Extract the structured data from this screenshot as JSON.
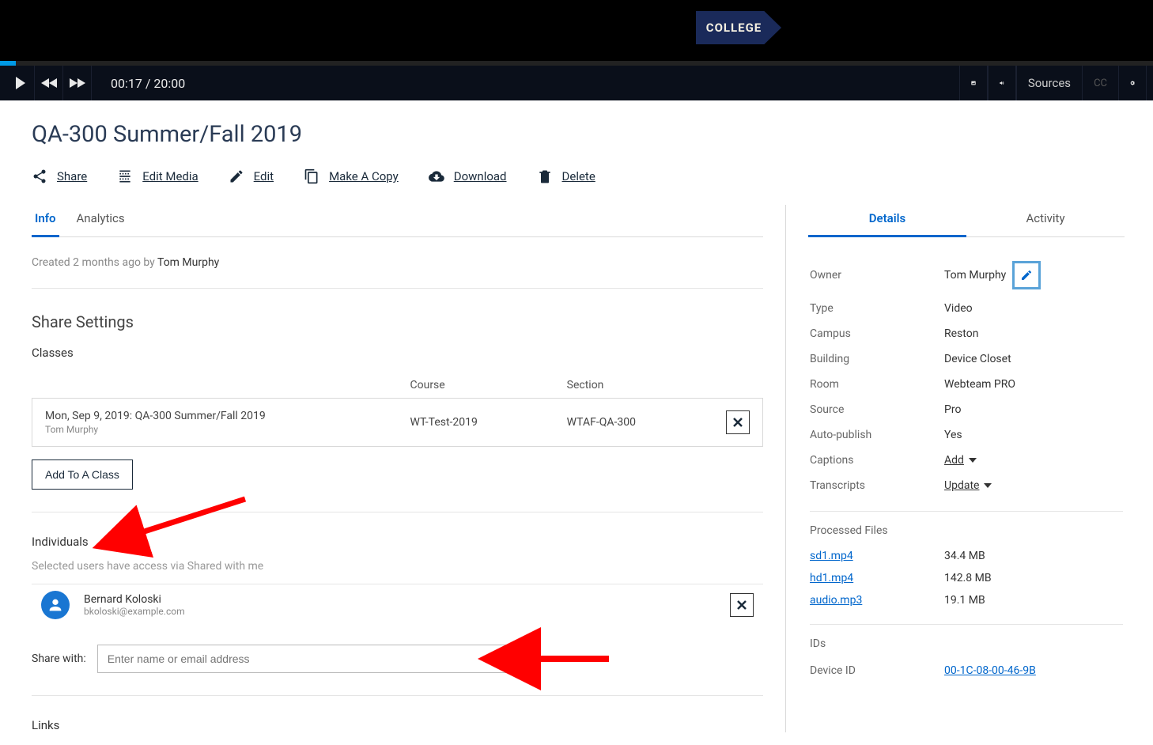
{
  "banner": {
    "badge_text": "COLLEGE"
  },
  "player": {
    "time_display": "00:17 / 20:00",
    "sources_label": "Sources",
    "cc_label": "CC"
  },
  "page_title": "QA-300 Summer/Fall 2019",
  "toolbar": {
    "share": "Share",
    "edit_media": "Edit Media",
    "edit": "Edit",
    "copy": "Make A Copy",
    "download": "Download",
    "delete": "Delete"
  },
  "main_tabs": {
    "info": "Info",
    "analytics": "Analytics"
  },
  "side_tabs": {
    "details": "Details",
    "activity": "Activity"
  },
  "meta": {
    "prefix": "Created 2 months ago by ",
    "author": "Tom Murphy"
  },
  "share_settings": {
    "title": "Share Settings",
    "classes_label": "Classes",
    "col_course": "Course",
    "col_section": "Section",
    "class_row": {
      "title": "Mon, Sep 9, 2019: QA-300 Summer/Fall 2019",
      "sub": "Tom Murphy",
      "course": "WT-Test-2019",
      "section": "WTAF-QA-300"
    },
    "add_class_btn": "Add To A Class",
    "individuals_label": "Individuals",
    "individuals_sub": "Selected users have access via Shared with me",
    "individual": {
      "name": "Bernard Koloski",
      "email": "bkoloski@example.com"
    },
    "share_with_label": "Share with:",
    "share_with_placeholder": "Enter name or email address",
    "links_label": "Links"
  },
  "details": {
    "owner_label": "Owner",
    "owner_value": "Tom Murphy",
    "type_label": "Type",
    "type_value": "Video",
    "campus_label": "Campus",
    "campus_value": "Reston",
    "building_label": "Building",
    "building_value": "Device Closet",
    "room_label": "Room",
    "room_value": "Webteam PRO",
    "source_label": "Source",
    "source_value": "Pro",
    "autopub_label": "Auto-publish",
    "autopub_value": "Yes",
    "captions_label": "Captions",
    "captions_action": "Add",
    "transcripts_label": "Transcripts",
    "transcripts_action": "Update",
    "processed_files_label": "Processed Files",
    "files": [
      {
        "name": "sd1.mp4",
        "size": "34.4 MB"
      },
      {
        "name": "hd1.mp4",
        "size": "142.8 MB"
      },
      {
        "name": "audio.mp3",
        "size": "19.1 MB"
      }
    ],
    "ids_label": "IDs",
    "device_id_label": "Device ID",
    "device_id_value": "00-1C-08-00-46-9B"
  }
}
